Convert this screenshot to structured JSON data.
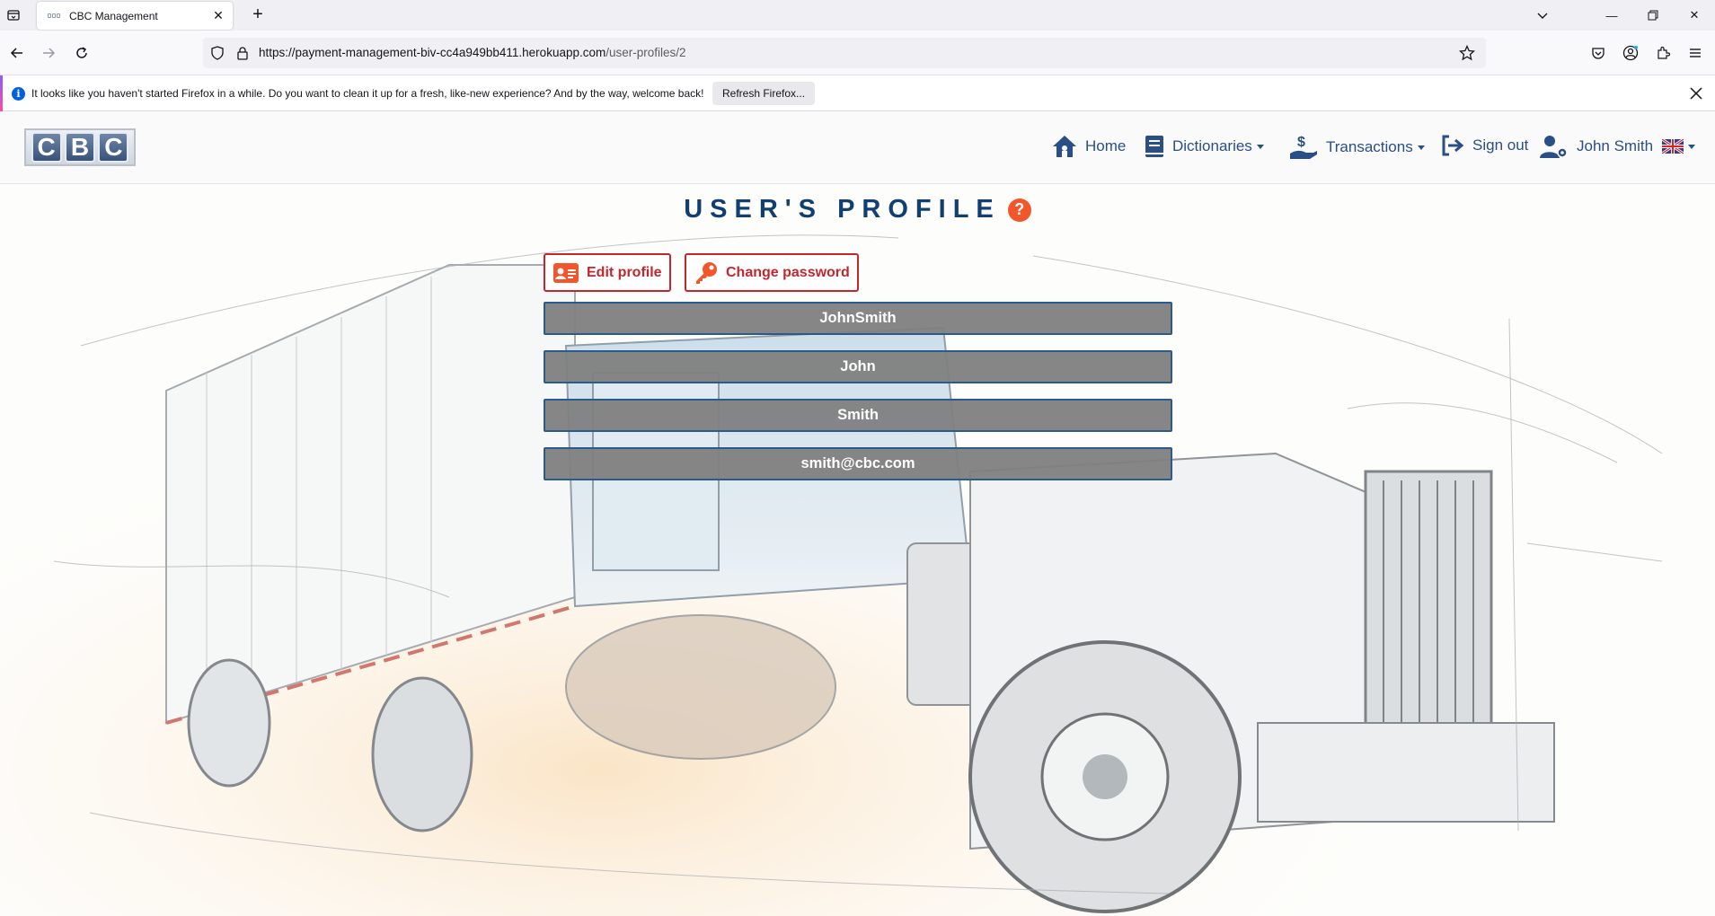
{
  "browser": {
    "tab_title": "CBC Management",
    "url_main": "https://payment-management-biv-cc4a949bb411.herokuapp.com",
    "url_path": "/user-profiles/2",
    "notification_text": "It looks like you haven't started Firefox in a while. Do you want to clean it up for a fresh, like-new experience? And by the way, welcome back!",
    "notification_button": "Refresh Firefox..."
  },
  "header": {
    "logo_letters": [
      "C",
      "B",
      "C"
    ],
    "nav": {
      "home": "Home",
      "dictionaries": "Dictionaries",
      "transactions": "Transactions",
      "sign_out": "Sign out",
      "user": "John Smith"
    }
  },
  "main": {
    "title": "USER'S PROFILE",
    "help": "?",
    "edit_profile": "Edit profile",
    "change_password": "Change password",
    "fields": {
      "username": "JohnSmith",
      "first_name": "John",
      "last_name": "Smith",
      "email": "smith@cbc.com"
    }
  },
  "colors": {
    "brand_blue": "#2a4f86",
    "title_blue": "#123f72",
    "accent_red": "#c4262c",
    "help_orange": "#f2562b",
    "field_gray": "#808080"
  }
}
